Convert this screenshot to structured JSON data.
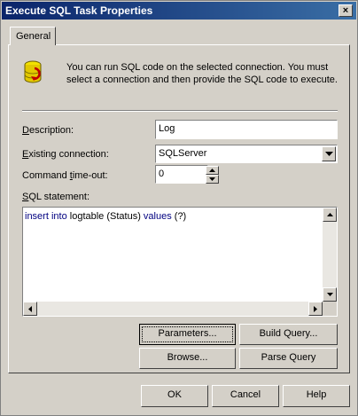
{
  "window": {
    "title": "Execute SQL Task Properties",
    "close_glyph": "×"
  },
  "tabs": [
    {
      "label": "General"
    }
  ],
  "info": {
    "text": "You can run SQL code on the selected connection.  You must select a connection and then provide the SQL code to execute."
  },
  "form": {
    "description": {
      "label": "Description:",
      "value": "Log"
    },
    "connection": {
      "label": "Existing connection:",
      "value": "SQLServer"
    },
    "timeout": {
      "label": "Command time-out:",
      "value": "0"
    },
    "sql": {
      "label": "SQL statement:",
      "statement": {
        "kw1": "insert into",
        "t1": " logtable (Status) ",
        "kw2": "values",
        "t2": " (?)"
      }
    }
  },
  "buttons": {
    "parameters": "Parameters...",
    "build_query": "Build Query...",
    "browse": "Browse...",
    "parse_query": "Parse Query",
    "ok": "OK",
    "cancel": "Cancel",
    "help": "Help"
  },
  "icons": {
    "dropdown": "chevron-down-icon",
    "spin_up": "spin-up-icon",
    "spin_down": "spin-down-icon",
    "task": "sql-task-icon"
  },
  "colors": {
    "title_bar": "#0a246a",
    "face": "#d4d0c8",
    "keyword": "#000080"
  }
}
